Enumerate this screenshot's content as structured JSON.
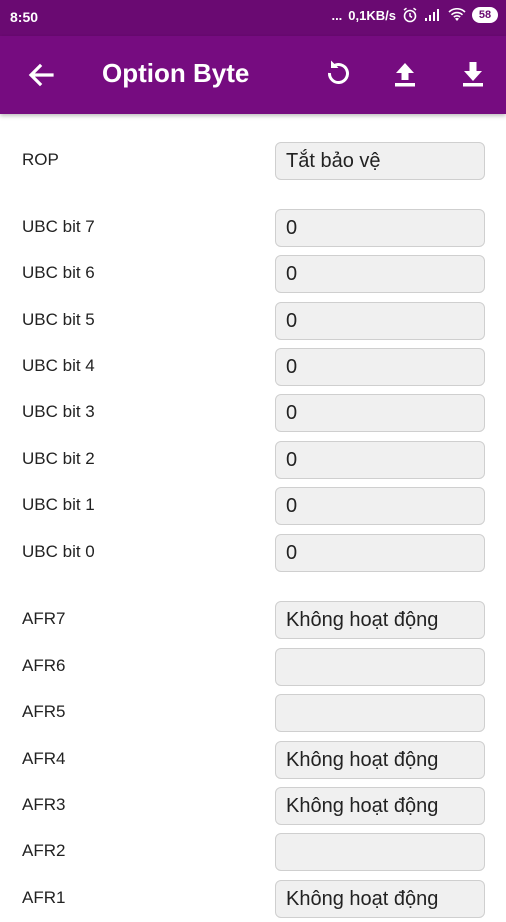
{
  "status_bar": {
    "time": "8:50",
    "dots": "...",
    "network_speed": "0,1KB/s",
    "battery": "58",
    "icons": [
      "alarm-icon",
      "signal-icon",
      "wifi-icon"
    ]
  },
  "app_bar": {
    "title": "Option Byte",
    "icons": [
      "back-arrow-icon",
      "refresh-icon",
      "upload-icon",
      "download-icon"
    ]
  },
  "colors": {
    "status_bar_bg": "#6a0a72",
    "app_bar_bg": "#760c80",
    "field_bg": "#f0f0f0"
  },
  "rows": [
    {
      "label": "ROP",
      "value": "Tắt bảo vệ"
    },
    {
      "label": "UBC bit 7",
      "value": "0"
    },
    {
      "label": "UBC bit 6",
      "value": "0"
    },
    {
      "label": "UBC bit 5",
      "value": "0"
    },
    {
      "label": "UBC bit 4",
      "value": "0"
    },
    {
      "label": "UBC bit 3",
      "value": "0"
    },
    {
      "label": "UBC bit 2",
      "value": "0"
    },
    {
      "label": "UBC bit 1",
      "value": "0"
    },
    {
      "label": "UBC bit 0",
      "value": "0"
    },
    {
      "label": "AFR7",
      "value": "Không hoạt động"
    },
    {
      "label": "AFR6",
      "value": ""
    },
    {
      "label": "AFR5",
      "value": ""
    },
    {
      "label": "AFR4",
      "value": "Không hoạt động"
    },
    {
      "label": "AFR3",
      "value": "Không hoạt động"
    },
    {
      "label": "AFR2",
      "value": ""
    },
    {
      "label": "AFR1",
      "value": "Không hoạt động"
    }
  ]
}
